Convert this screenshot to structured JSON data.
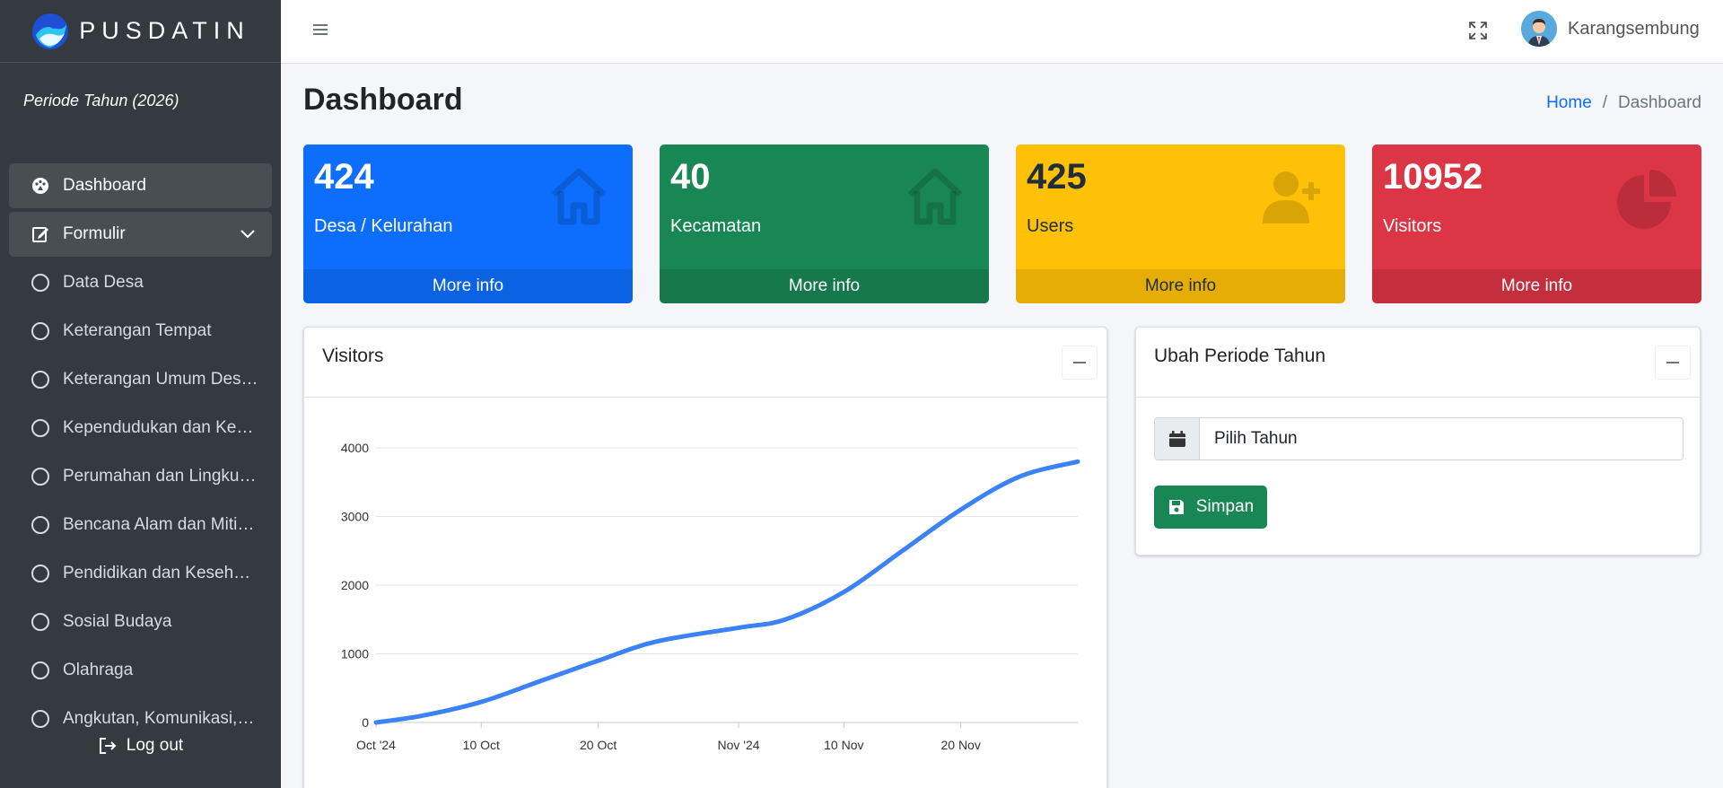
{
  "sidebar": {
    "brand": "PUSDATIN",
    "periode": "Periode Tahun (2026)",
    "items": [
      {
        "label": "Dashboard",
        "icon": "palette-icon"
      },
      {
        "label": "Formulir",
        "icon": "edit-icon"
      },
      {
        "label": "Data Desa",
        "icon": "circle-icon"
      },
      {
        "label": "Keterangan Tempat",
        "icon": "circle-icon"
      },
      {
        "label": "Keterangan Umum Des…",
        "icon": "circle-icon"
      },
      {
        "label": "Kependudukan dan Ke…",
        "icon": "circle-icon"
      },
      {
        "label": "Perumahan dan Lingku…",
        "icon": "circle-icon"
      },
      {
        "label": "Bencana Alam dan Miti…",
        "icon": "circle-icon"
      },
      {
        "label": "Pendidikan dan Keseh…",
        "icon": "circle-icon"
      },
      {
        "label": "Sosial Budaya",
        "icon": "circle-icon"
      },
      {
        "label": "Olahraga",
        "icon": "circle-icon"
      },
      {
        "label": "Angkutan, Komunikasi,…",
        "icon": "circle-icon"
      }
    ],
    "logout": "Log out"
  },
  "topbar": {
    "username": "Karangsembung"
  },
  "page": {
    "title": "Dashboard",
    "breadcrumb": {
      "home": "Home",
      "separator": "/",
      "current": "Dashboard"
    }
  },
  "stats": [
    {
      "value": "424",
      "label": "Desa / Kelurahan",
      "more": "More info",
      "color": "#0d6efd",
      "icon": "home-icon"
    },
    {
      "value": "40",
      "label": "Kecamatan",
      "more": "More info",
      "color": "#198754",
      "icon": "home-icon"
    },
    {
      "value": "425",
      "label": "Users",
      "more": "More info",
      "color": "#ffc107",
      "icon": "user-plus-icon"
    },
    {
      "value": "10952",
      "label": "Visitors",
      "more": "More info",
      "color": "#dc3545",
      "icon": "pie-chart-icon"
    }
  ],
  "visitors_panel": {
    "title": "Visitors"
  },
  "periode_panel": {
    "title": "Ubah Periode Tahun",
    "input_placeholder": "Pilih Tahun",
    "save_label": "Simpan"
  },
  "chart_data": {
    "type": "line",
    "title": "",
    "xlabel": "",
    "ylabel": "",
    "ylim": [
      0,
      4000
    ],
    "yticks": [
      0,
      1000,
      2000,
      3000,
      4000
    ],
    "xticks": [
      "Oct '24",
      "10 Oct",
      "20 Oct",
      "Nov '24",
      "10 Nov",
      "20 Nov"
    ],
    "xlim": [
      "2024-10-01",
      "2024-11-30"
    ],
    "grid": true,
    "color": "#3b82f6",
    "series": [
      {
        "x": [
          "2024-10-01",
          "2024-10-05",
          "2024-10-10",
          "2024-10-15",
          "2024-10-20",
          "2024-10-25",
          "2024-11-01",
          "2024-11-05",
          "2024-11-10",
          "2024-11-15",
          "2024-11-20",
          "2024-11-25",
          "2024-11-30"
        ],
        "values": [
          0,
          100,
          300,
          600,
          900,
          1180,
          1380,
          1500,
          1900,
          2500,
          3100,
          3580,
          3800
        ]
      }
    ]
  }
}
